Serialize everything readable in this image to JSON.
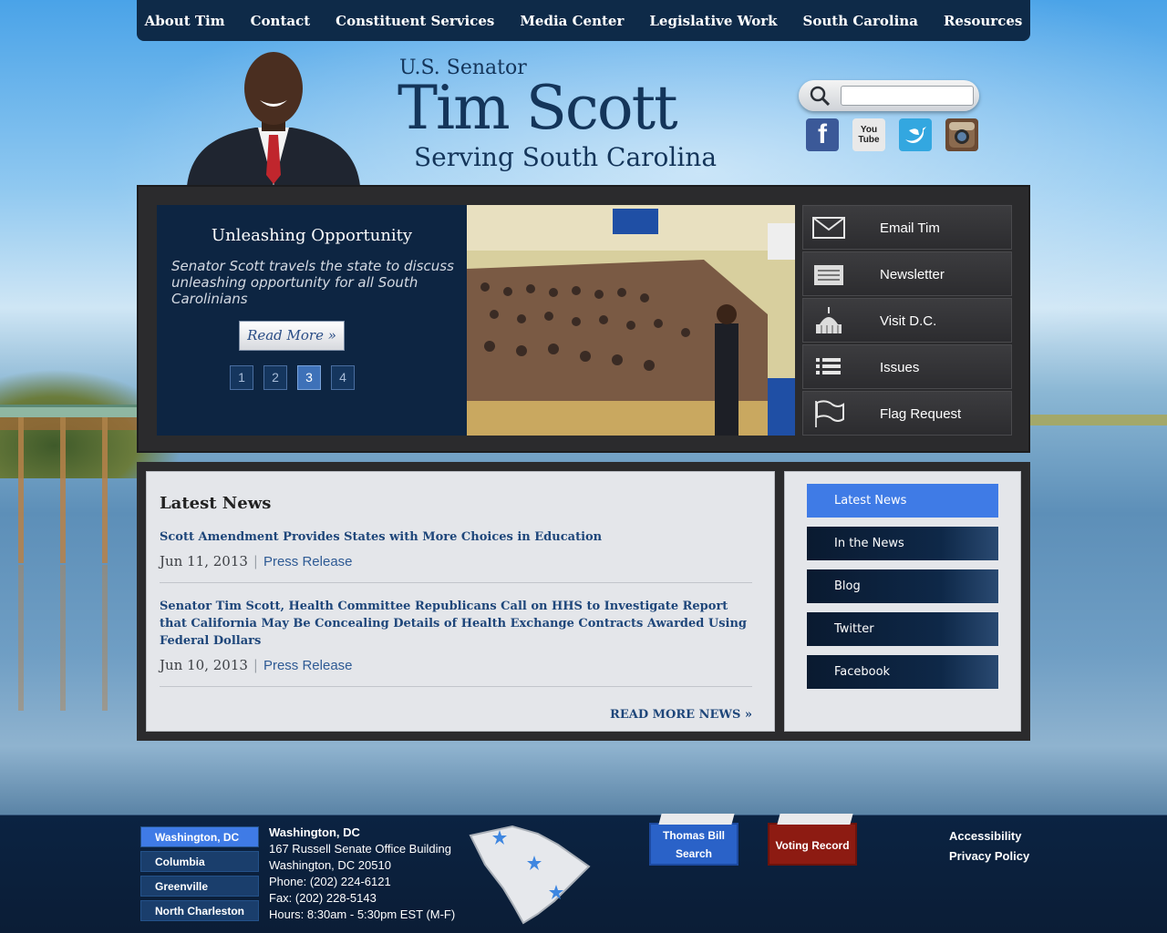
{
  "nav": [
    "About Tim",
    "Contact",
    "Constituent Services",
    "Media Center",
    "Legislative Work",
    "South Carolina",
    "Resources"
  ],
  "header": {
    "logo_line1": "U.S. Senator",
    "logo_line2": "Tim Scott",
    "logo_line3": "Serving South Carolina",
    "search_placeholder": ""
  },
  "social": [
    {
      "name": "facebook-icon",
      "glyph": "f"
    },
    {
      "name": "youtube-icon",
      "glyph": "You Tube"
    },
    {
      "name": "twitter-icon",
      "glyph": "t"
    },
    {
      "name": "instagram-icon",
      "glyph": "ig"
    }
  ],
  "slider": {
    "title": "Unleashing Opportunity",
    "description": "Senator Scott travels the state to discuss unleashing opportunity for all South Carolinians",
    "read_more": "Read More »",
    "pages": [
      "1",
      "2",
      "3",
      "4"
    ],
    "active_page": "3"
  },
  "quick_links": [
    "Email Tim",
    "Newsletter",
    "Visit D.C.",
    "Issues",
    "Flag Request"
  ],
  "news": {
    "heading": "Latest News",
    "items": [
      {
        "title": "Scott Amendment Provides States with More Choices in Education",
        "date": "Jun 11, 2013",
        "category": "Press Release"
      },
      {
        "title": "Senator Tim Scott, Health Committee Republicans Call on HHS to Investigate Report that California May Be Concealing Details of Health Exchange Contracts Awarded Using Federal Dollars",
        "date": "Jun 10, 2013",
        "category": "Press Release"
      }
    ],
    "more": "READ MORE NEWS »"
  },
  "news_tabs": [
    "Latest News",
    "In the News",
    "Blog",
    "Twitter",
    "Facebook"
  ],
  "footer": {
    "offices": [
      "Washington, DC",
      "Columbia",
      "Greenville",
      "North Charleston"
    ],
    "address": {
      "name": "Washington, DC",
      "line1": "167 Russell Senate Office Building",
      "line2": "Washington, DC 20510",
      "phone": "Phone: (202) 224-6121",
      "fax": "Fax: (202) 228-5143",
      "hours": "Hours: 8:30am - 5:30pm EST (M-F)"
    },
    "thomas_line1": "Thomas Bill",
    "thomas_line2": "Search",
    "voting_record": "Voting Record",
    "accessibility": "Accessibility",
    "privacy": "Privacy Policy"
  }
}
